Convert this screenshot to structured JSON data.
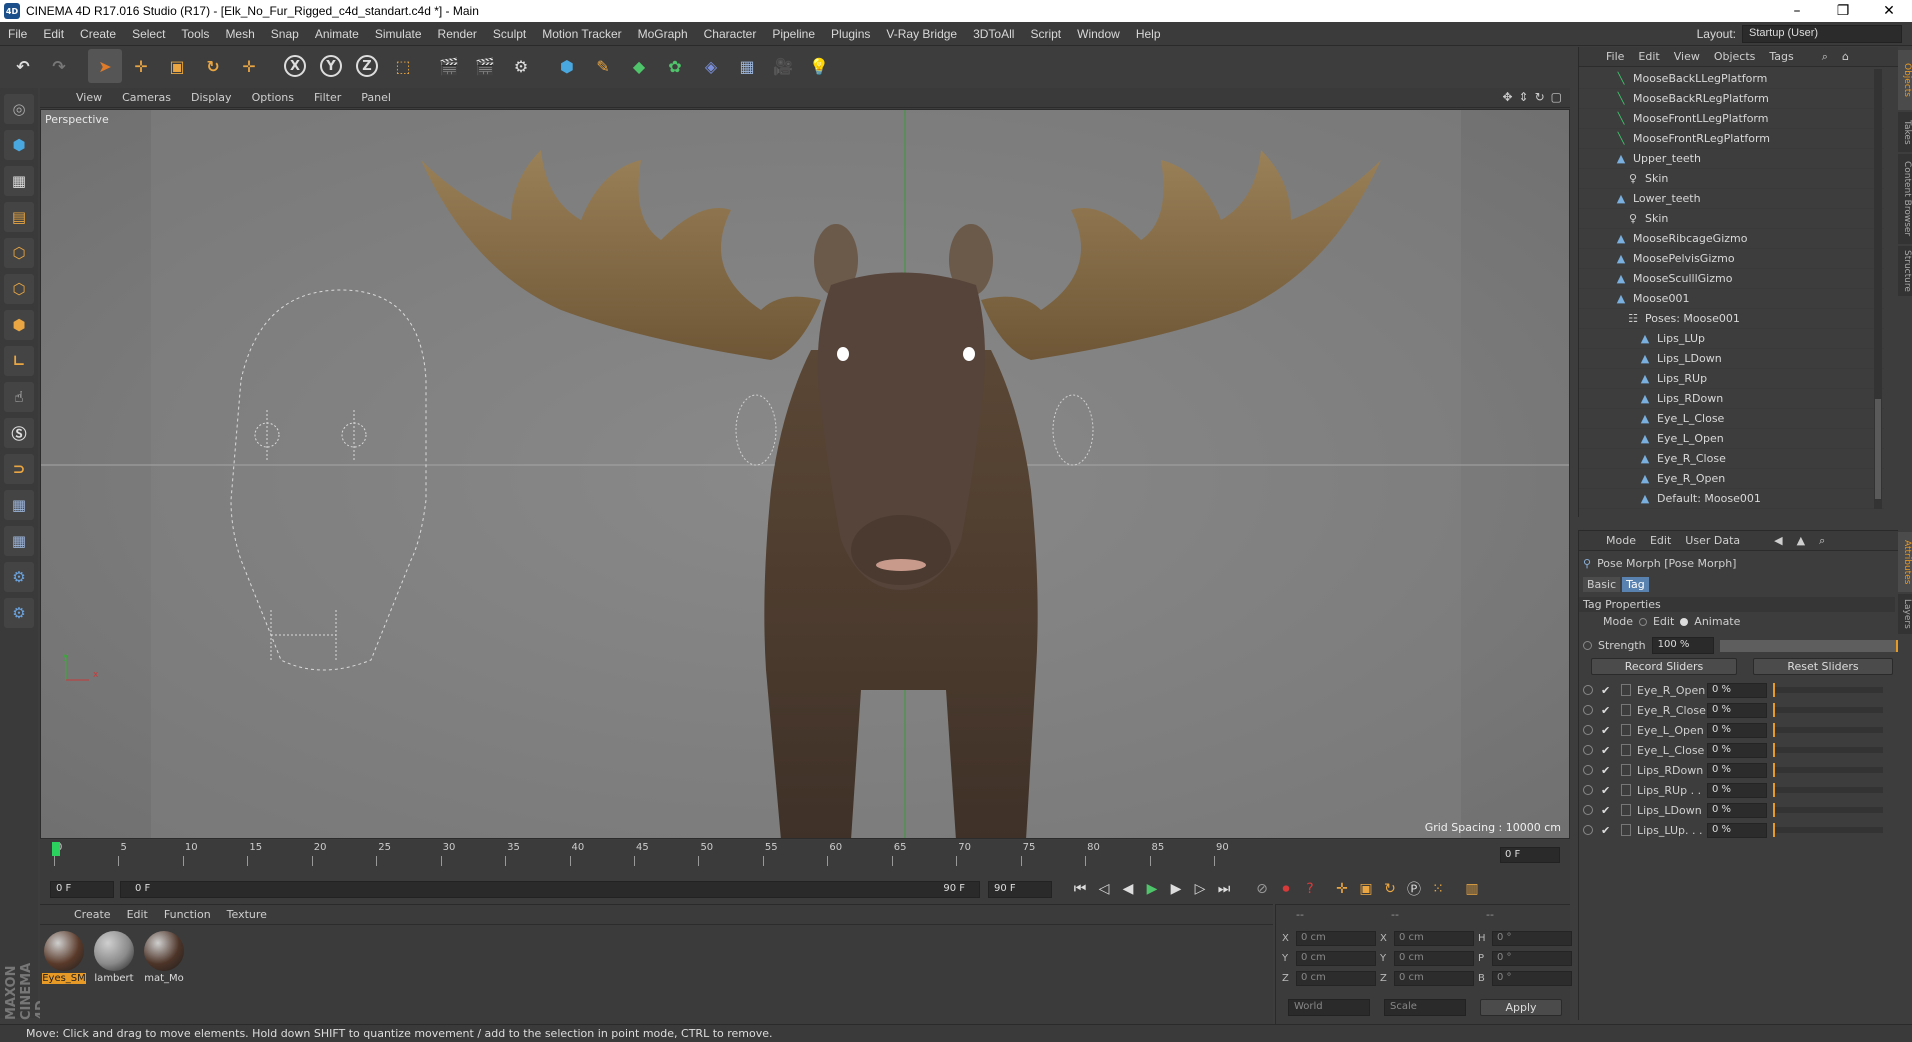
{
  "window": {
    "title": "CINEMA 4D R17.016 Studio (R17) - [Elk_No_Fur_Rigged_c4d_standart.c4d *] - Main",
    "icon_label": "4D",
    "minimize": "–",
    "maximize": "❐",
    "close": "✕"
  },
  "menu": [
    "File",
    "Edit",
    "Create",
    "Select",
    "Tools",
    "Mesh",
    "Snap",
    "Animate",
    "Simulate",
    "Render",
    "Sculpt",
    "Motion Tracker",
    "MoGraph",
    "Character",
    "Pipeline",
    "Plugins",
    "V-Ray Bridge",
    "3DToAll",
    "Script",
    "Window",
    "Help"
  ],
  "layout": {
    "label": "Layout:",
    "value": "Startup (User)"
  },
  "toolbar_icons": {
    "undo": "↶",
    "redo": "↷",
    "select": "➤",
    "move": "✛",
    "scale": "▣",
    "rotate": "↻",
    "recent": "✛",
    "x": "X",
    "y": "Y",
    "z": "Z",
    "coord": "⬚",
    "render_view": "🎬",
    "render_pv": "🎬",
    "render_settings": "⚙",
    "cube": "⬢",
    "pen": "✎",
    "subdiv": "◆",
    "cloner": "✿",
    "deformer": "◈",
    "floor": "▦",
    "camera": "🎥",
    "light": "💡"
  },
  "viewport": {
    "menus": [
      "View",
      "Cameras",
      "Display",
      "Options",
      "Filter",
      "Panel"
    ],
    "label": "Perspective",
    "grid_spacing": "Grid Spacing : 10000 cm",
    "axis_y": "y",
    "axis_x": "x"
  },
  "timeline": {
    "ticks": [
      "0",
      "5",
      "10",
      "15",
      "20",
      "25",
      "30",
      "35",
      "40",
      "45",
      "50",
      "55",
      "60",
      "65",
      "70",
      "75",
      "80",
      "85",
      "90"
    ],
    "current_frame": "0 F"
  },
  "transport": {
    "start": "0 F",
    "range_start": "0 F",
    "range_end": "90 F",
    "end": "90 F",
    "icons": {
      "first": "⏮",
      "prev_key": "◁",
      "prev": "◀",
      "play": "▶",
      "next": "▶",
      "next_key": "▷",
      "last": "⏭"
    }
  },
  "material_manager": {
    "menus": [
      "Create",
      "Edit",
      "Function",
      "Texture"
    ],
    "materials": [
      {
        "name": "Eyes_SM",
        "color": "#5a3a2a"
      },
      {
        "name": "lambert",
        "color": "#8a8a8a"
      },
      {
        "name": "mat_Mo",
        "color": "#4d3428"
      }
    ]
  },
  "coordinates": {
    "headers": [
      "--",
      "--",
      "--"
    ],
    "rows": [
      {
        "l1": "X",
        "v1": "0 cm",
        "l2": "X",
        "v2": "0 cm",
        "l3": "H",
        "v3": "0 °"
      },
      {
        "l1": "Y",
        "v1": "0 cm",
        "l2": "Y",
        "v2": "0 cm",
        "l3": "P",
        "v3": "0 °"
      },
      {
        "l1": "Z",
        "v1": "0 cm",
        "l2": "Z",
        "v2": "0 cm",
        "l3": "B",
        "v3": "0 °"
      }
    ],
    "space": "World",
    "mode": "Scale",
    "apply": "Apply"
  },
  "status": "Move: Click and drag to move elements. Hold down SHIFT to quantize movement / add to the selection in point mode, CTRL to remove.",
  "brand": "MAXON CINEMA 4D",
  "object_manager": {
    "menus": [
      "File",
      "Edit",
      "View",
      "Objects",
      "Tags"
    ],
    "objects": [
      {
        "name": "MooseBackLLegPlatform",
        "indent": 1,
        "type": "spline"
      },
      {
        "name": "MooseBackRLegPlatform",
        "indent": 1,
        "type": "spline"
      },
      {
        "name": "MooseFrontLLegPlatform",
        "indent": 1,
        "type": "spline"
      },
      {
        "name": "MooseFrontRLegPlatform",
        "indent": 1,
        "type": "spline"
      },
      {
        "name": "Upper_teeth",
        "indent": 1,
        "type": "mesh"
      },
      {
        "name": "Skin",
        "indent": 2,
        "type": "skin"
      },
      {
        "name": "Lower_teeth",
        "indent": 1,
        "type": "mesh"
      },
      {
        "name": "Skin",
        "indent": 2,
        "type": "skin"
      },
      {
        "name": "MooseRibcageGizmo",
        "indent": 1,
        "type": "mesh"
      },
      {
        "name": "MoosePelvisGizmo",
        "indent": 1,
        "type": "mesh"
      },
      {
        "name": "MooseSculllGizmo",
        "indent": 1,
        "type": "mesh"
      },
      {
        "name": "Moose001",
        "indent": 1,
        "type": "mesh"
      },
      {
        "name": "Poses: Moose001",
        "indent": 2,
        "type": "pose"
      },
      {
        "name": "Lips_LUp",
        "indent": 3,
        "type": "mesh"
      },
      {
        "name": "Lips_LDown",
        "indent": 3,
        "type": "mesh"
      },
      {
        "name": "Lips_RUp",
        "indent": 3,
        "type": "mesh"
      },
      {
        "name": "Lips_RDown",
        "indent": 3,
        "type": "mesh"
      },
      {
        "name": "Eye_L_Close",
        "indent": 3,
        "type": "mesh"
      },
      {
        "name": "Eye_L_Open",
        "indent": 3,
        "type": "mesh"
      },
      {
        "name": "Eye_R_Close",
        "indent": 3,
        "type": "mesh"
      },
      {
        "name": "Eye_R_Open",
        "indent": 3,
        "type": "mesh"
      },
      {
        "name": "Default: Moose001",
        "indent": 3,
        "type": "mesh"
      }
    ]
  },
  "attributes": {
    "menus": [
      "Mode",
      "Edit",
      "User Data"
    ],
    "object": "Pose Morph [Pose Morph]",
    "tabs": [
      "Basic",
      "Tag"
    ],
    "section": "Tag Properties",
    "mode_label": "Mode",
    "mode_edit": "Edit",
    "mode_animate": "Animate",
    "strength_label": "Strength",
    "strength_value": "100 %",
    "record": "Record Sliders",
    "reset": "Reset Sliders",
    "sliders": [
      {
        "name": "Eye_R_Open",
        "value": "0 %"
      },
      {
        "name": "Eye_R_Close",
        "value": "0 %"
      },
      {
        "name": "Eye_L_Open",
        "value": "0 %"
      },
      {
        "name": "Eye_L_Close",
        "value": "0 %"
      },
      {
        "name": "Lips_RDown",
        "value": "0 %"
      },
      {
        "name": "Lips_RUp . .",
        "value": "0 %"
      },
      {
        "name": "Lips_LDown",
        "value": "0 %"
      },
      {
        "name": "Lips_LUp. . .",
        "value": "0 %"
      }
    ]
  },
  "side_tabs": [
    "Objects",
    "Takes",
    "Content Browser",
    "Structure",
    "Attributes",
    "Layers"
  ]
}
